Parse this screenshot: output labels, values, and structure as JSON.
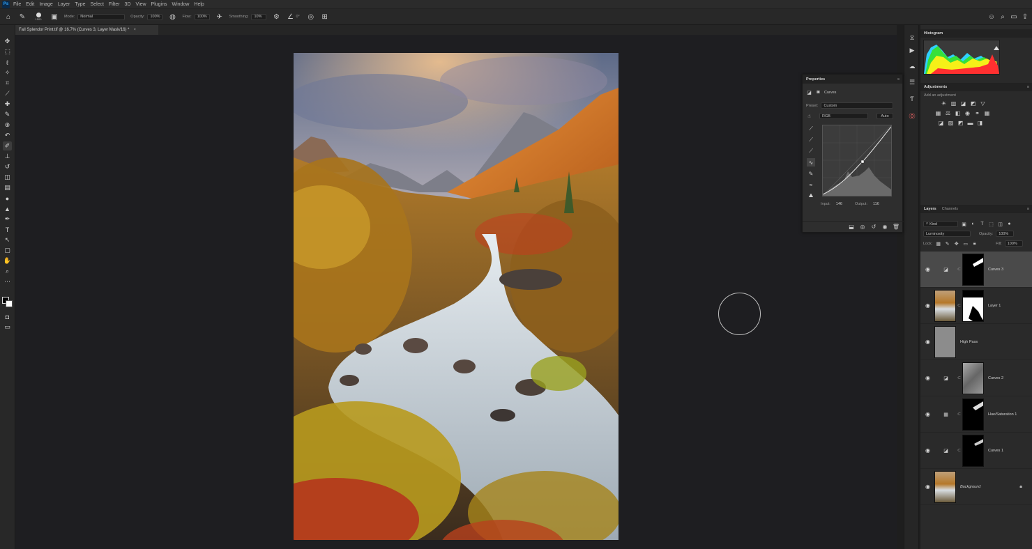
{
  "app": {
    "logo": "Ps",
    "menu": [
      "File",
      "Edit",
      "Image",
      "Layer",
      "Type",
      "Select",
      "Filter",
      "3D",
      "View",
      "Plugins",
      "Window",
      "Help"
    ]
  },
  "options": {
    "brush_size": "1500",
    "mode_label": "Mode:",
    "mode_value": "Normal",
    "opacity_label": "Opacity:",
    "opacity_value": "100%",
    "flow_label": "Flow:",
    "flow_value": "100%",
    "smoothing_label": "Smoothing:",
    "smoothing_value": "10%",
    "angle_value": "0°"
  },
  "document": {
    "tab_title": "Fall Splendor Print.tif @ 16.7% (Curves 3, Layer Mask/16) *",
    "close_glyph": "×"
  },
  "panels": {
    "histogram": {
      "title": "Histogram"
    },
    "adjustments": {
      "title": "Adjustments",
      "subtitle": "Add an adjustment"
    },
    "layers": {
      "tab_layers": "Layers",
      "tab_channels": "Channels",
      "filter_kind": "Kind",
      "blend_mode": "Luminosity",
      "opacity_label": "Opacity:",
      "opacity_value": "100%",
      "lock_label": "Lock:",
      "fill_label": "Fill:",
      "fill_value": "100%",
      "items": [
        {
          "name": "Curves 3",
          "type": "curves",
          "selected": true
        },
        {
          "name": "Layer 1",
          "type": "pixel",
          "selected": false
        },
        {
          "name": "High Pass",
          "type": "gray",
          "selected": false
        },
        {
          "name": "Curves 2",
          "type": "curves",
          "selected": false
        },
        {
          "name": "Hue/Saturation 1",
          "type": "huesat",
          "selected": false
        },
        {
          "name": "Curves 1",
          "type": "curves",
          "selected": false
        },
        {
          "name": "Background",
          "type": "background",
          "selected": false
        }
      ]
    }
  },
  "properties": {
    "title": "Properties",
    "subtitle": "Curves",
    "preset_label": "Preset:",
    "preset_value": "Custom",
    "channel_value": "RGB",
    "auto_label": "Auto",
    "input_label": "Input:",
    "input_value": "146",
    "output_label": "Output:",
    "output_value": "116"
  },
  "icons": {
    "home": "home-icon",
    "brush": "brush-icon",
    "eye": "eye-icon",
    "lock": "lock-icon"
  },
  "colors": {
    "accent": "#31a8ff",
    "panel_bg": "#2a2a2a",
    "canvas_bg": "#1e1e21",
    "selected_layer": "#4a4a4a"
  }
}
